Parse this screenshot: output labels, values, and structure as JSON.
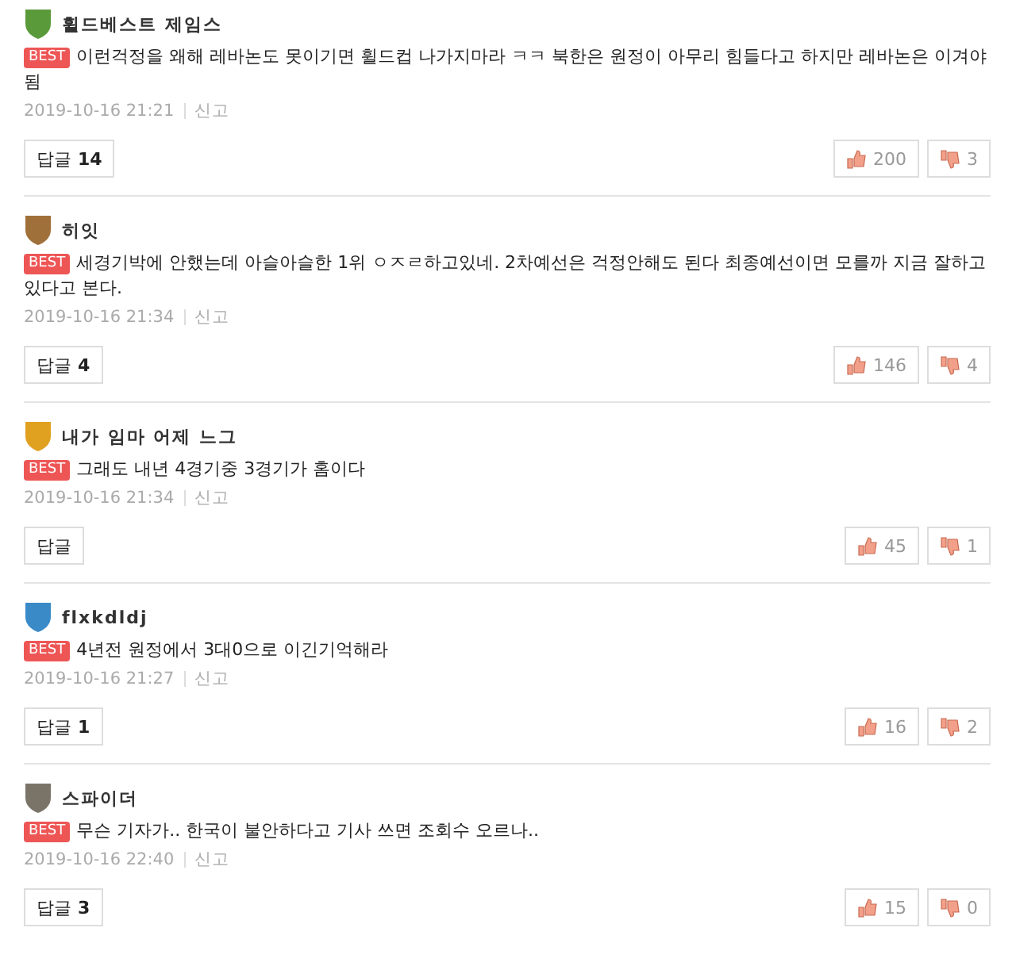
{
  "comments": [
    {
      "author": "휠드베스트 제임스",
      "color": "#5a9a3a",
      "best": "BEST",
      "text": "이런걱정을 왜해 레바논도 못이기면 휠드컵 나가지마라 ㅋㅋ 북한은 원정이 아무리 힘들다고 하지만 레바논은 이겨야됨",
      "date": "2019-10-16 21:21",
      "report": "신고",
      "reply_label": "답글",
      "reply_count": "14",
      "likes": "200",
      "dislikes": "3"
    },
    {
      "author": "히잇",
      "color": "#a0703a",
      "best": "BEST",
      "text": "세경기박에 안했는데 아슬아슬한 1위 ㅇㅈㄹ하고있네. 2차예선은 걱정안해도 된다 최종예선이면 모를까 지금 잘하고 있다고 본다.",
      "date": "2019-10-16 21:34",
      "report": "신고",
      "reply_label": "답글",
      "reply_count": "4",
      "likes": "146",
      "dislikes": "4"
    },
    {
      "author": "내가 임마 어제 느그",
      "color": "#e0a020",
      "best": "BEST",
      "text": "그래도 내년 4경기중 3경기가 홈이다",
      "date": "2019-10-16 21:34",
      "report": "신고",
      "reply_label": "답글",
      "likes": "45",
      "dislikes": "1"
    },
    {
      "author": "flxkdldj",
      "color": "#3a8ac8",
      "best": "BEST",
      "text": "4년전 원정에서 3대0으로 이긴기억해라",
      "date": "2019-10-16 21:27",
      "report": "신고",
      "reply_label": "답글",
      "reply_count": "1",
      "likes": "16",
      "dislikes": "2"
    },
    {
      "author": "스파이더",
      "color": "#7a7468",
      "best": "BEST",
      "text": "무슨 기자가.. 한국이 불안하다고 기사 쓰면 조회수 오르나..",
      "date": "2019-10-16 22:40",
      "report": "신고",
      "reply_label": "답글",
      "reply_count": "3",
      "likes": "15",
      "dislikes": "0"
    }
  ]
}
